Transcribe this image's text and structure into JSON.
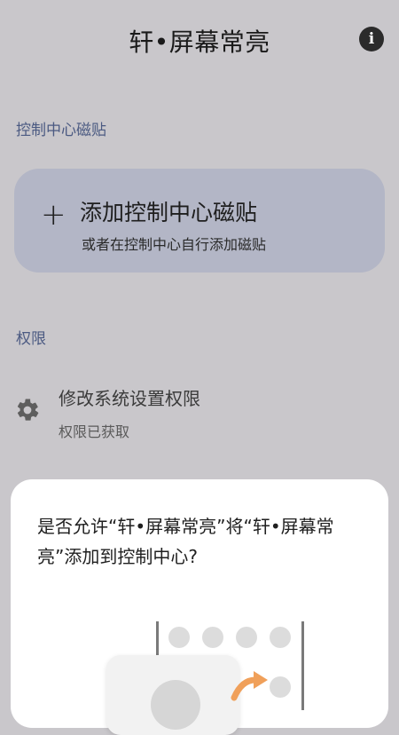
{
  "header": {
    "title": "轩•屏幕常亮",
    "info_icon": "info-icon"
  },
  "sections": {
    "tiles_title": "控制中心磁贴",
    "permissions_title": "权限"
  },
  "tile_card": {
    "plus_icon": "+",
    "title": "添加控制中心磁贴",
    "subtitle": "或者在控制中心自行添加磁贴"
  },
  "permission": {
    "icon": "gear-icon",
    "title": "修改系统设置权限",
    "status": "权限已获取"
  },
  "dialog": {
    "message": "是否允许“轩•屏幕常亮”将“轩•屏幕常亮”添加到控制中心?"
  },
  "colors": {
    "background": "#c9c7cb",
    "card": "#b3b6c6",
    "section_title": "#4b5a82",
    "accent_arrow": "#f0a05a"
  }
}
